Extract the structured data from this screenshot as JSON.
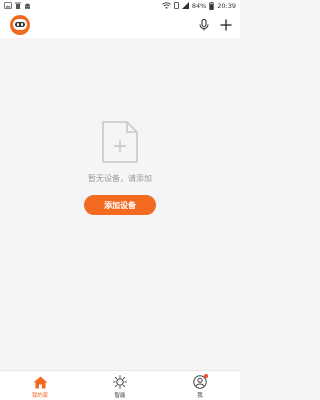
{
  "status_bar": {
    "battery_percent": "84%",
    "time": "20:39"
  },
  "header": {
    "mic_icon": "microphone-icon",
    "add_icon": "plus-icon"
  },
  "empty_state": {
    "message": "暂无设备，请添加",
    "button_label": "添加设备"
  },
  "bottom_nav": {
    "items": [
      {
        "label": "我的家",
        "icon": "home-icon",
        "active": true
      },
      {
        "label": "智能",
        "icon": "sun-icon",
        "active": false
      },
      {
        "label": "我",
        "icon": "user-icon",
        "active": false,
        "badge": true
      }
    ]
  },
  "colors": {
    "accent": "#f26a20",
    "background": "#f5f5f5",
    "badge": "#f0463c"
  }
}
